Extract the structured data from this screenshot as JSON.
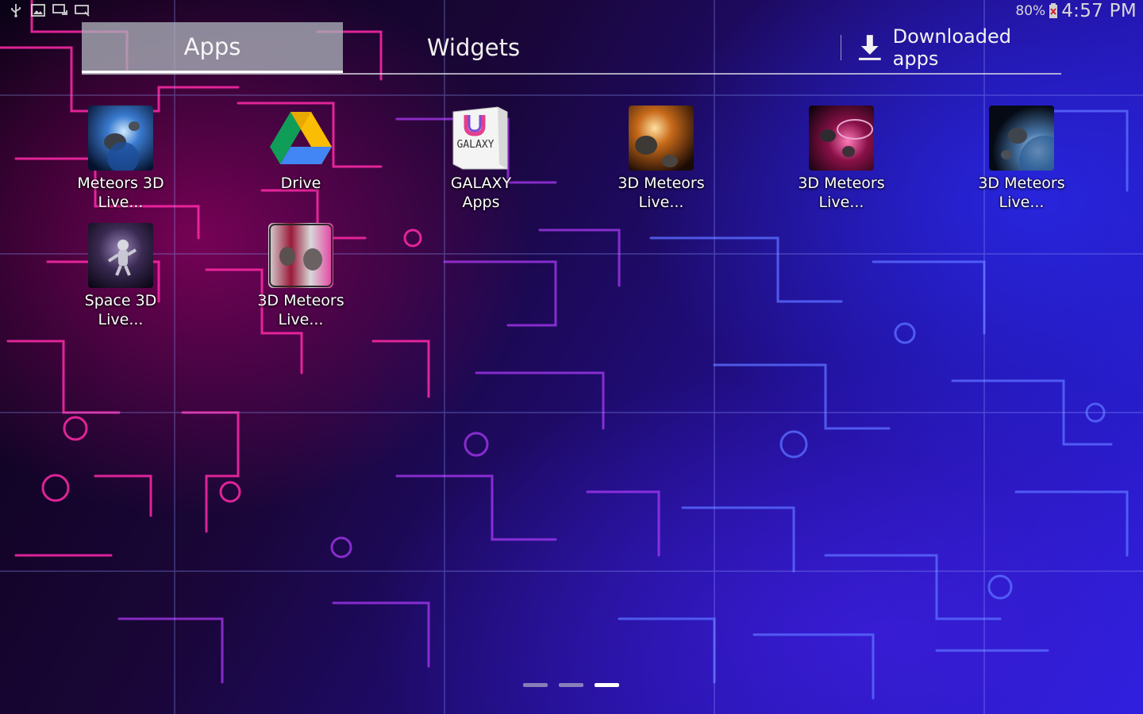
{
  "status_bar": {
    "battery_percent": "80%",
    "time": "4:57 PM",
    "left_icons": [
      "usb-icon",
      "image-icon",
      "screen-mirror-icon",
      "cast-icon"
    ]
  },
  "tabs": {
    "apps_label": "Apps",
    "widgets_label": "Widgets",
    "downloaded_label": "Downloaded apps"
  },
  "apps": [
    {
      "label_line1": "Meteors 3D",
      "label_line2": "Live...",
      "icon": "meteors-3d-icon"
    },
    {
      "label_line1": "Drive",
      "label_line2": "",
      "icon": "drive-icon"
    },
    {
      "label_line1": "GALAXY",
      "label_line2": "Apps",
      "icon": "galaxy-apps-icon",
      "icon_text": "GALAXY"
    },
    {
      "label_line1": "3D Meteors",
      "label_line2": "Live...",
      "icon": "3d-meteors-icon"
    },
    {
      "label_line1": "3D Meteors",
      "label_line2": "Live...",
      "icon": "3d-meteors-icon"
    },
    {
      "label_line1": "3D Meteors",
      "label_line2": "Live...",
      "icon": "3d-meteors-icon"
    },
    {
      "label_line1": "Space 3D",
      "label_line2": "Live...",
      "icon": "space-3d-icon"
    },
    {
      "label_line1": "3D Meteors",
      "label_line2": "Live...",
      "icon": "3d-meteors-icon"
    }
  ],
  "pager": {
    "pages": 3,
    "active_index": 2
  },
  "colors": {
    "tab_selected_bg": "#aaafb9",
    "wallpaper_magenta": "#ff1aa0",
    "wallpaper_blue": "#2a20e0"
  }
}
